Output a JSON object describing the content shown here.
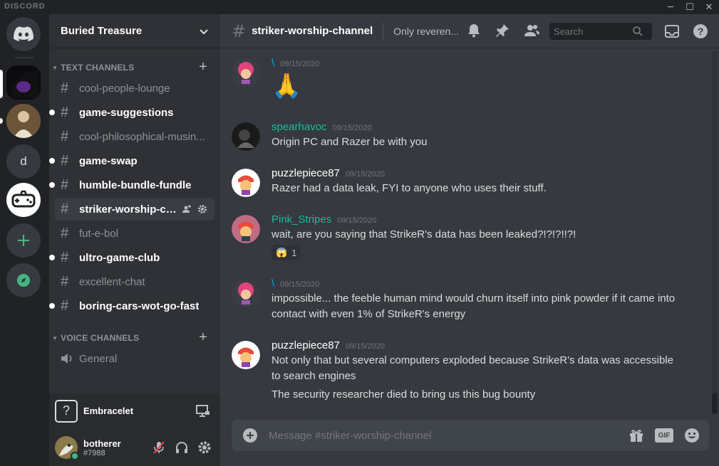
{
  "app": {
    "title": "DISCORD"
  },
  "window": {
    "minimize": "─",
    "maximize": "☐",
    "close": "✕"
  },
  "guilds": {
    "dm_label": "",
    "letter_guild": "d"
  },
  "server": {
    "name": "Buried Treasure"
  },
  "categories": {
    "text": "TEXT CHANNELS",
    "voice": "VOICE CHANNELS"
  },
  "channels": [
    {
      "name": "cool-people-lounge",
      "unread": false,
      "active": false
    },
    {
      "name": "game-suggestions",
      "unread": true,
      "active": false
    },
    {
      "name": "cool-philosophical-musin...",
      "unread": false,
      "active": false
    },
    {
      "name": "game-swap",
      "unread": true,
      "active": false
    },
    {
      "name": "humble-bundle-fundle",
      "unread": true,
      "active": false
    },
    {
      "name": "striker-worship-ch...",
      "unread": false,
      "active": true
    },
    {
      "name": "fut-e-bol",
      "unread": false,
      "active": false
    },
    {
      "name": "ultro-game-club",
      "unread": true,
      "active": false
    },
    {
      "name": "excellent-chat",
      "unread": false,
      "active": false
    },
    {
      "name": "boring-cars-wot-go-fast",
      "unread": true,
      "active": false
    }
  ],
  "voice_channels": [
    {
      "name": "General"
    }
  ],
  "rtc": {
    "name": "Embracelet"
  },
  "user": {
    "name": "botherer",
    "tag": "#7988",
    "status_color": "#43b581"
  },
  "chat": {
    "channel": "striker-worship-channel",
    "topic": "Only reveren...",
    "search_placeholder": "Search",
    "composer_placeholder": "Message #striker-worship-channel"
  },
  "messages": [
    {
      "author": "\\",
      "author_color": "#00b0f4",
      "time": "09/15/2020",
      "text": "🙏"
    },
    {
      "author": "spearhavoc",
      "author_color": "#1abc9c",
      "time": "09/15/2020",
      "text": "Origin PC and Razer be with you"
    },
    {
      "author": "puzzlepiece87",
      "author_color": "#ffffff",
      "time": "09/15/2020",
      "text": "Razer had a data leak, FYI to anyone who uses their stuff."
    },
    {
      "author": "Pink_Stripes",
      "author_color": "#1abc9c",
      "time": "09/15/2020",
      "text": "wait, are you saying that StrikeR's data has been leaked?!?!?!!?!",
      "reaction_emoji": "😱",
      "reaction_count": "1"
    },
    {
      "author": "\\",
      "author_color": "#00b0f4",
      "time": "09/15/2020",
      "text": "impossible... the feeble human mind would churn itself into pink powder if it came into contact with even 1% of StrikeR's energy"
    },
    {
      "author": "puzzlepiece87",
      "author_color": "#ffffff",
      "time": "09/15/2020",
      "text": "Not only that but several computers exploded because StrikeR's data was accessible to search engines",
      "text2": "The security researcher died to bring us this bug bounty"
    }
  ],
  "colors": {
    "accent": "#7289da",
    "green": "#43b581",
    "bg": "#36393f"
  }
}
